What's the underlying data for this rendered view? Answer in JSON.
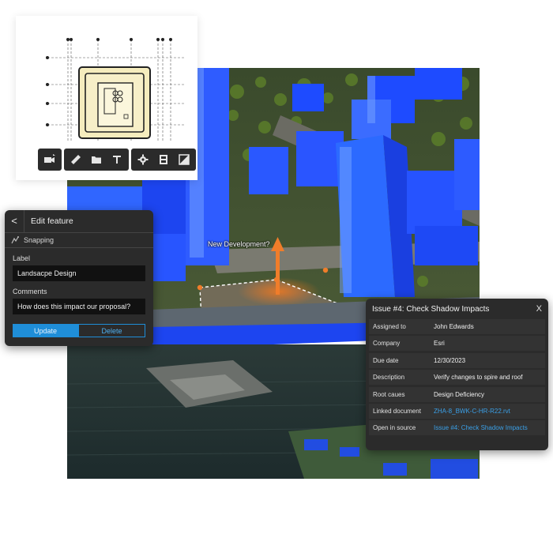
{
  "map": {
    "annotation": "New Development?"
  },
  "plan_toolbar": {
    "groups": [
      [
        "camera-icon"
      ],
      [
        "ruler-icon",
        "folder-icon",
        "text-icon"
      ],
      [
        "gear-icon",
        "save-icon",
        "layers-icon"
      ]
    ]
  },
  "edit_panel": {
    "back_label": "<",
    "title": "Edit feature",
    "snapping_label": "Snapping",
    "label_caption": "Label",
    "label_value": "Landsacpe Design",
    "comments_caption": "Comments",
    "comments_value": "How does this impact our proposal?",
    "update_label": "Update",
    "delete_label": "Delete"
  },
  "issue_panel": {
    "title": "Issue #4: Check Shadow Impacts",
    "close_label": "X",
    "rows": [
      {
        "key": "Assigned to",
        "value": "John Edwards"
      },
      {
        "key": "Company",
        "value": "Esri"
      },
      {
        "key": "Due date",
        "value": "12/30/2023"
      },
      {
        "key": "Description",
        "value": "Verify changes to spire and roof"
      },
      {
        "key": "Root caues",
        "value": "Design Deficiency"
      },
      {
        "key": "Linked document",
        "value": "ZHA-8_BWK-C-HR-R22.rvt"
      },
      {
        "key": "Open in source",
        "value": "Issue #4: Check Shadow Impacts"
      }
    ],
    "link_color": "#3aa0e8"
  },
  "colors": {
    "panel_bg": "#2b2b2b",
    "accent": "#1f8ed8",
    "building_blue": "#1e4bff"
  }
}
